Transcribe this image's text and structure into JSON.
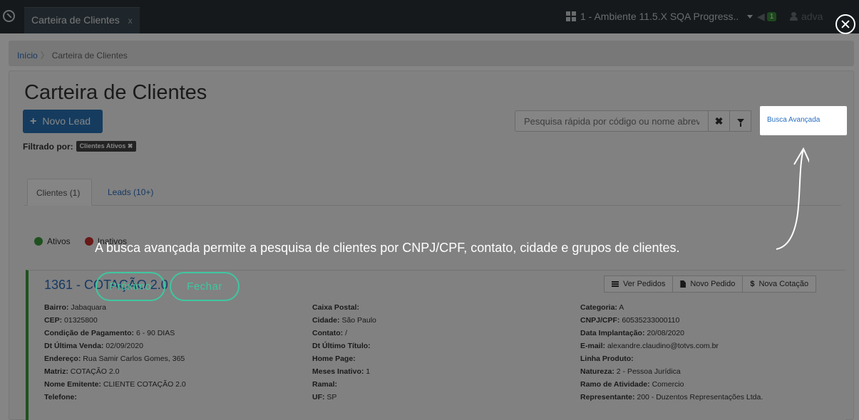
{
  "header": {
    "tab_label": "Carteira de Clientes",
    "tab_close": "x",
    "environment": "1 - Ambiente 11.5.X SQA Progress..",
    "notification_count": "1",
    "user": "adva"
  },
  "breadcrumb": {
    "home": "Início",
    "current": "Carteira de Clientes"
  },
  "page": {
    "title": "Carteira de Clientes",
    "new_lead_label": "Novo Lead",
    "filter_label": "Filtrado por:",
    "filter_tag": "Clientes Ativos ✖",
    "search_placeholder": "Pesquisa rápida por código ou nome abreviado",
    "advanced_search": "Busca Avançada"
  },
  "tabs": [
    {
      "label": "Clientes (1)"
    },
    {
      "label": "Leads (10+)"
    }
  ],
  "status": {
    "active": "Ativos",
    "inactive": "Inativos"
  },
  "client": {
    "title": "1361 - COTAÇÃO 2.0",
    "buttons": {
      "orders": "Ver Pedidos",
      "new_order": "Novo Pedido",
      "new_quote": "Nova Cotação",
      "quote_symbol": "$"
    },
    "col1": [
      {
        "k": "Bairro:",
        "v": "Jabaquara"
      },
      {
        "k": "CEP:",
        "v": "01325800"
      },
      {
        "k": "Condição de Pagamento:",
        "v": "6 - 90 DIAS"
      },
      {
        "k": "Dt Última Venda:",
        "v": "02/09/2020"
      },
      {
        "k": "Endereço:",
        "v": "Rua Samir Carlos Gomes, 365"
      },
      {
        "k": "Matriz:",
        "v": "COTAÇÃO 2.0"
      },
      {
        "k": "Nome Emitente:",
        "v": "CLIENTE COTAÇÃO 2.0"
      },
      {
        "k": "Telefone:",
        "v": ""
      }
    ],
    "col2": [
      {
        "k": "Caixa Postal:",
        "v": ""
      },
      {
        "k": "Cidade:",
        "v": "São Paulo"
      },
      {
        "k": "Contato:",
        "v": "/"
      },
      {
        "k": "Dt Último Título:",
        "v": ""
      },
      {
        "k": "Home Page:",
        "v": ""
      },
      {
        "k": "Meses Inativo:",
        "v": "1"
      },
      {
        "k": "Ramal:",
        "v": ""
      },
      {
        "k": "UF:",
        "v": "SP"
      }
    ],
    "col3": [
      {
        "k": "Categoria:",
        "v": "A"
      },
      {
        "k": "CNPJ/CPF:",
        "v": "60535233000110"
      },
      {
        "k": "Data Implantação:",
        "v": "20/08/2020"
      },
      {
        "k": "E-mail:",
        "v": "alexandre.claudino@totvs.com.br"
      },
      {
        "k": "Linha Produto:",
        "v": ""
      },
      {
        "k": "Natureza:",
        "v": "2 - Pessoa Jurídica"
      },
      {
        "k": "Ramo de Atividade:",
        "v": "Comercio"
      },
      {
        "k": "Representante:",
        "v": "200 - Duzentos Representações Ltda."
      }
    ]
  },
  "tour": {
    "message": "A busca avançada permite a pesquisa de clientes por CNPJ/CPF, contato, cidade e grupos de clientes.",
    "next": "Próximo",
    "close": "Fechar"
  }
}
